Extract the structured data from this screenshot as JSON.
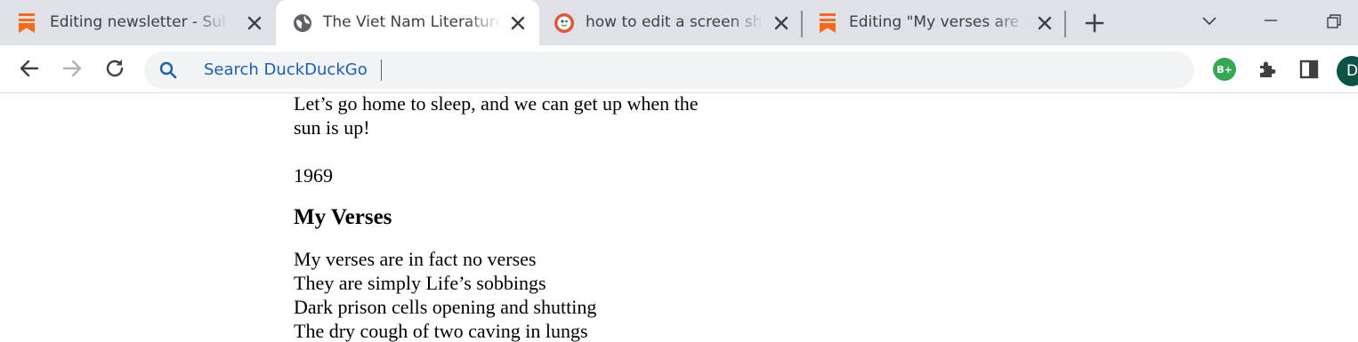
{
  "browser": {
    "tabs": [
      {
        "title": "Editing newsletter - Substack",
        "icon": "substack-icon",
        "active": false
      },
      {
        "title": "The Viet Nam Literature Project",
        "icon": "globe-icon",
        "active": true
      },
      {
        "title": "how to edit a screen shot",
        "icon": "duckduckgo-icon",
        "active": false
      },
      {
        "title": "Editing \"My verses are in fact no verses\"",
        "icon": "substack-icon",
        "active": false
      }
    ],
    "omnibox": {
      "placeholder": "Search DuckDuckGo"
    },
    "extensions": [
      {
        "name": "grammarly-extension",
        "label": "B+"
      },
      {
        "name": "puzzle-icon"
      },
      {
        "name": "side-panel-icon"
      }
    ],
    "profile": {
      "initial": "D"
    },
    "colors": {
      "tabstrip": "#dee1e6",
      "substack": "#ff6719",
      "omnibox_text": "#1a5fb4",
      "avatar": "#0b5345"
    }
  },
  "page": {
    "intro_lines": [
      "Let’s go home to sleep, and we can get up when the",
      "sun is up!"
    ],
    "year": "1969",
    "poem_title": "My Verses",
    "verse_lines": [
      "My verses are in fact no verses",
      "They are simply Life’s sobbings",
      "Dark prison cells opening and shutting",
      "The dry cough of two caving in lungs"
    ]
  }
}
